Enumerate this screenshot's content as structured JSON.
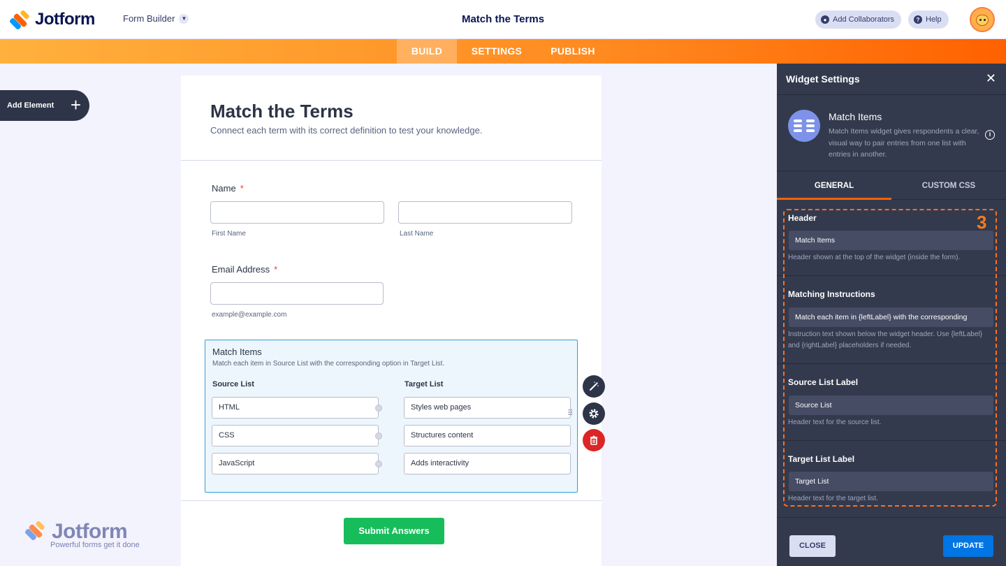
{
  "topbar": {
    "logo_text": "Jotform",
    "form_builder": "Form Builder",
    "title": "Match the Terms",
    "add_collaborators": "Add Collaborators",
    "help": "Help"
  },
  "nav": {
    "build": "BUILD",
    "settings": "SETTINGS",
    "publish": "PUBLISH"
  },
  "left": {
    "add_element": "Add Element",
    "plus": "+"
  },
  "form": {
    "title": "Match the Terms",
    "subtitle": "Connect each term with its correct definition to test your knowledge.",
    "name_label": "Name",
    "required_mark": "*",
    "first_name": "First Name",
    "last_name": "Last Name",
    "email_label": "Email Address",
    "email_hint": "example@example.com",
    "widget": {
      "title": "Match Items",
      "subtitle": "Match each item in Source List with the corresponding option in Target List.",
      "source_label": "Source List",
      "target_label": "Target List",
      "source_items": [
        "HTML",
        "CSS",
        "JavaScript"
      ],
      "target_items": [
        "Styles web pages",
        "Structures content",
        "Adds interactivity"
      ]
    },
    "submit": "Submit Answers"
  },
  "watermark": {
    "text": "Jotform",
    "tagline": "Powerful forms get it done"
  },
  "panel": {
    "title": "Widget Settings",
    "close_glyph": "✕",
    "widget_name": "Match Items",
    "widget_desc": "Match Items widget gives respondents a clear, visual way to pair entries from one list with entries in another.",
    "tabs": [
      "GENERAL",
      "CUSTOM CSS"
    ],
    "step": "3",
    "fields": [
      {
        "label": "Header",
        "value": "Match Items",
        "help": "Header shown at the top of the widget (inside the form)."
      },
      {
        "label": "Matching Instructions",
        "value": "Match each item in {leftLabel} with the corresponding",
        "help": "Instruction text shown below the widget header. Use {leftLabel} and {rightLabel} placeholders if needed."
      },
      {
        "label": "Source List Label",
        "value": "Source List",
        "help": "Header text for the source list."
      },
      {
        "label": "Target List Label",
        "value": "Target List",
        "help": "Header text for the target list."
      }
    ],
    "close_button": "CLOSE",
    "update_button": "UPDATE"
  },
  "colors": {
    "accent": "#ff6100",
    "panel_bg": "#333a4d",
    "submit_green": "#18bd5b",
    "update_blue": "#0075e3"
  }
}
